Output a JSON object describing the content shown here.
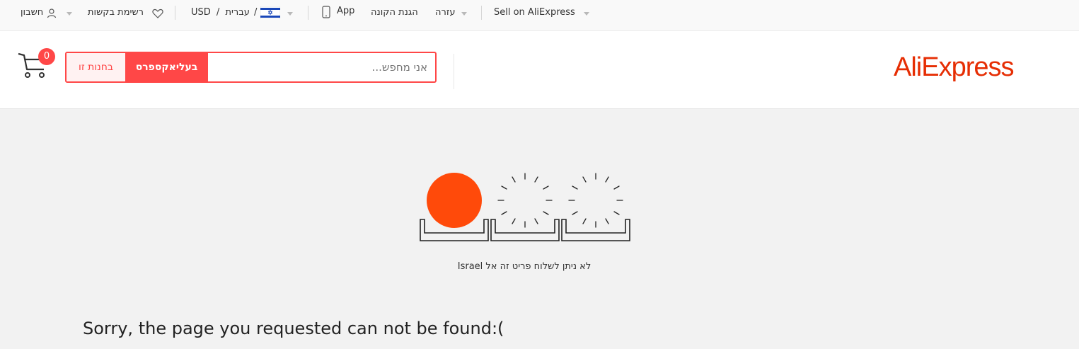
{
  "topbar": {
    "account_label": "חשבון",
    "wishlist_label": "רשימת בקשות",
    "currency": "USD",
    "language": "עברית",
    "separator": "/",
    "app_label": "App",
    "buyer_protection": "הגנת הקונה",
    "help": "עזרה",
    "sell": "Sell on AliExpress"
  },
  "header": {
    "cart_count": "0",
    "search_placeholder": "אני מחפש...",
    "search_site_button": "בעליאקספרס",
    "search_store_button": "בחנות זו",
    "logo": "AliExpress"
  },
  "main": {
    "shipping_message": "Israel לא ניתן לשלוח פריט זה אל",
    "not_found": "Sorry, the page you requested can not be found:("
  },
  "colors": {
    "accent": "#ff4747",
    "logo": "#e62e04",
    "sun": "#ff4a0a"
  }
}
